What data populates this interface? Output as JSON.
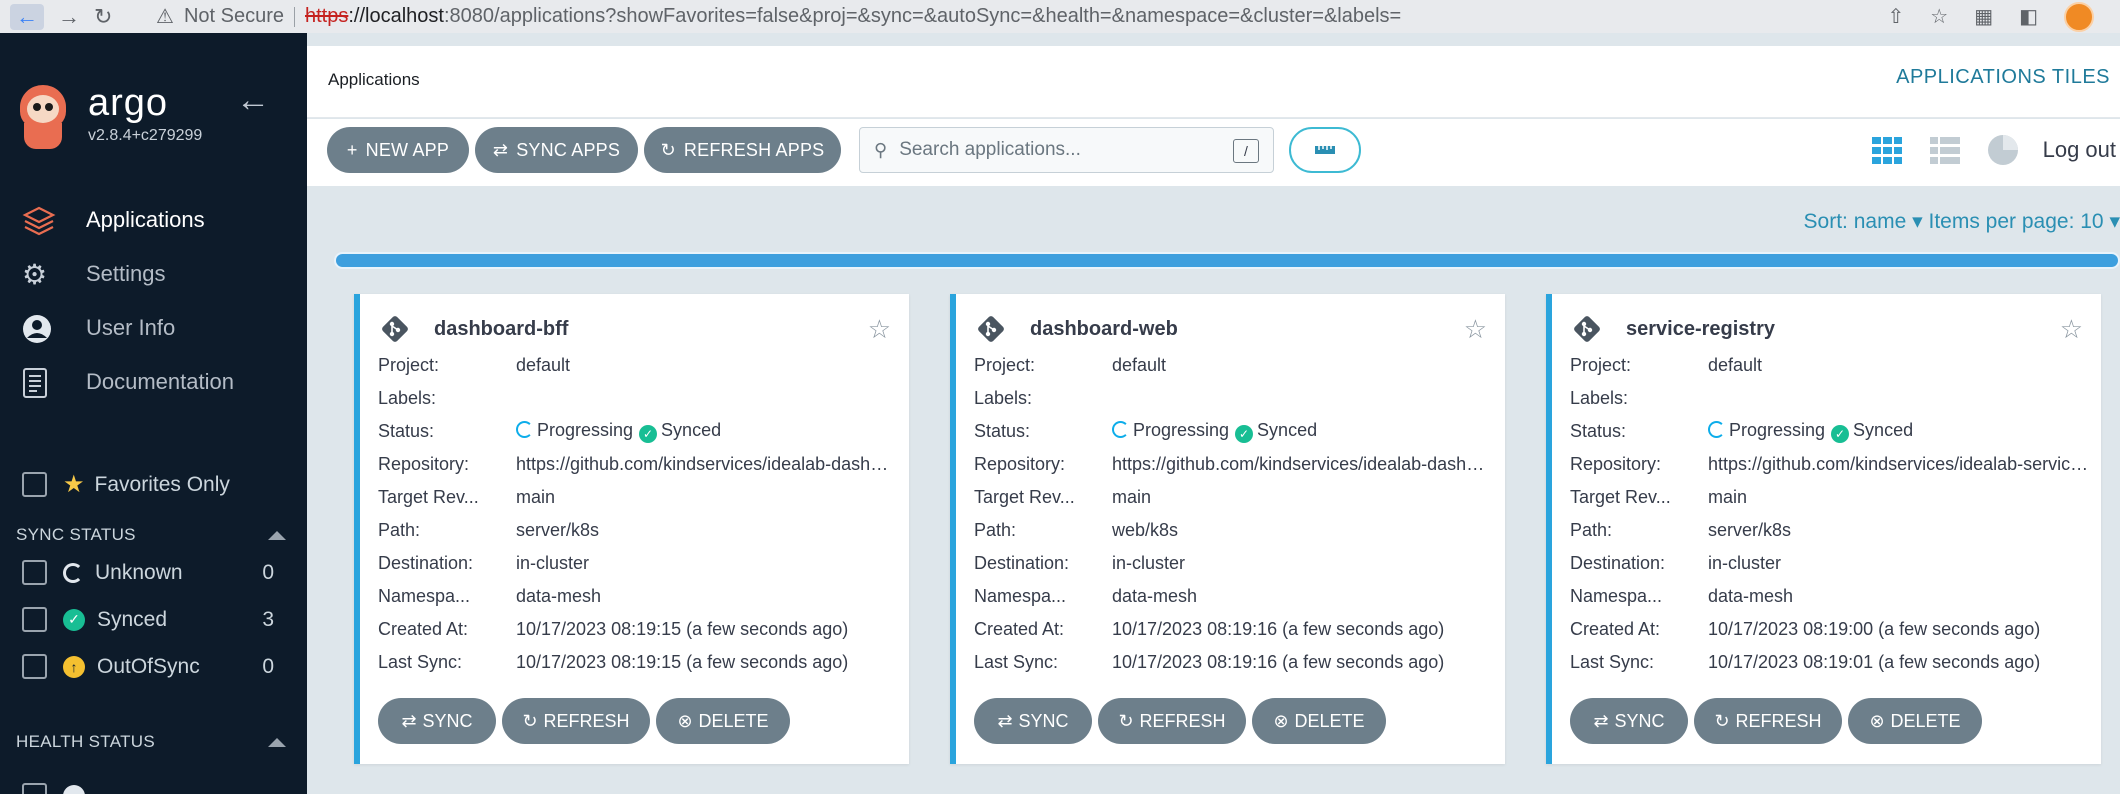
{
  "browser": {
    "security_label": "Not Secure",
    "url_scheme": "https",
    "url_host": "://localhost",
    "url_rest": ":8080/applications?showFavorites=false&proj=&sync=&autoSync=&health=&namespace=&cluster=&labels="
  },
  "sidebar": {
    "brand": "argo",
    "version": "v2.8.4+c279299",
    "menu": [
      {
        "label": "Applications",
        "icon": "layers-icon"
      },
      {
        "label": "Settings",
        "icon": "gear-icon"
      },
      {
        "label": "User Info",
        "icon": "user-icon"
      },
      {
        "label": "Documentation",
        "icon": "document-icon"
      }
    ],
    "favorites_label": "Favorites Only",
    "sync_status": {
      "title": "SYNC STATUS",
      "filters": [
        {
          "label": "Unknown",
          "count": "0"
        },
        {
          "label": "Synced",
          "count": "3"
        },
        {
          "label": "OutOfSync",
          "count": "0"
        }
      ]
    },
    "health_status": {
      "title": "HEALTH STATUS"
    }
  },
  "header": {
    "breadcrumb": "Applications",
    "view_title": "APPLICATIONS TILES"
  },
  "toolbar": {
    "new_app": "NEW APP",
    "sync_apps": "SYNC APPS",
    "refresh_apps": "REFRESH APPS",
    "search_placeholder": "Search applications...",
    "search_shortcut": "/",
    "logout": "Log out"
  },
  "sort": {
    "label": "Sort: name",
    "per_page": "Items per page: 10"
  },
  "field_labels": {
    "project": "Project:",
    "labels": "Labels:",
    "status": "Status:",
    "repository": "Repository:",
    "target_revision": "Target Rev...",
    "path": "Path:",
    "destination": "Destination:",
    "namespace": "Namespa...",
    "created_at": "Created At:",
    "last_sync": "Last Sync:"
  },
  "status_labels": {
    "health": "Progressing",
    "sync": "Synced"
  },
  "card_actions": {
    "sync": "SYNC",
    "refresh": "REFRESH",
    "delete": "DELETE"
  },
  "apps": [
    {
      "name": "dashboard-bff",
      "project": "default",
      "labels": "",
      "repository": "https://github.com/kindservices/idealab-dashboard-bff",
      "target_revision": "main",
      "path": "server/k8s",
      "destination": "in-cluster",
      "namespace": "data-mesh",
      "created_at": "10/17/2023 08:19:15  (a few seconds ago)",
      "last_sync": "10/17/2023 08:19:15  (a few seconds ago)"
    },
    {
      "name": "dashboard-web",
      "project": "default",
      "labels": "",
      "repository": "https://github.com/kindservices/idealab-dashboard-web",
      "target_revision": "main",
      "path": "web/k8s",
      "destination": "in-cluster",
      "namespace": "data-mesh",
      "created_at": "10/17/2023 08:19:16  (a few seconds ago)",
      "last_sync": "10/17/2023 08:19:16  (a few seconds ago)"
    },
    {
      "name": "service-registry",
      "project": "default",
      "labels": "",
      "repository": "https://github.com/kindservices/idealab-service-registry",
      "target_revision": "main",
      "path": "server/k8s",
      "destination": "in-cluster",
      "namespace": "data-mesh",
      "created_at": "10/17/2023 08:19:00  (a few seconds ago)",
      "last_sync": "10/17/2023 08:19:01  (a few seconds ago)"
    }
  ],
  "colors": {
    "sidebar_bg": "#0d1b2a",
    "accent": "#2aa4dd",
    "button": "#6d7f8b",
    "synced": "#18be94",
    "progressing": "#0dadea",
    "out_of_sync": "#f4c030"
  }
}
